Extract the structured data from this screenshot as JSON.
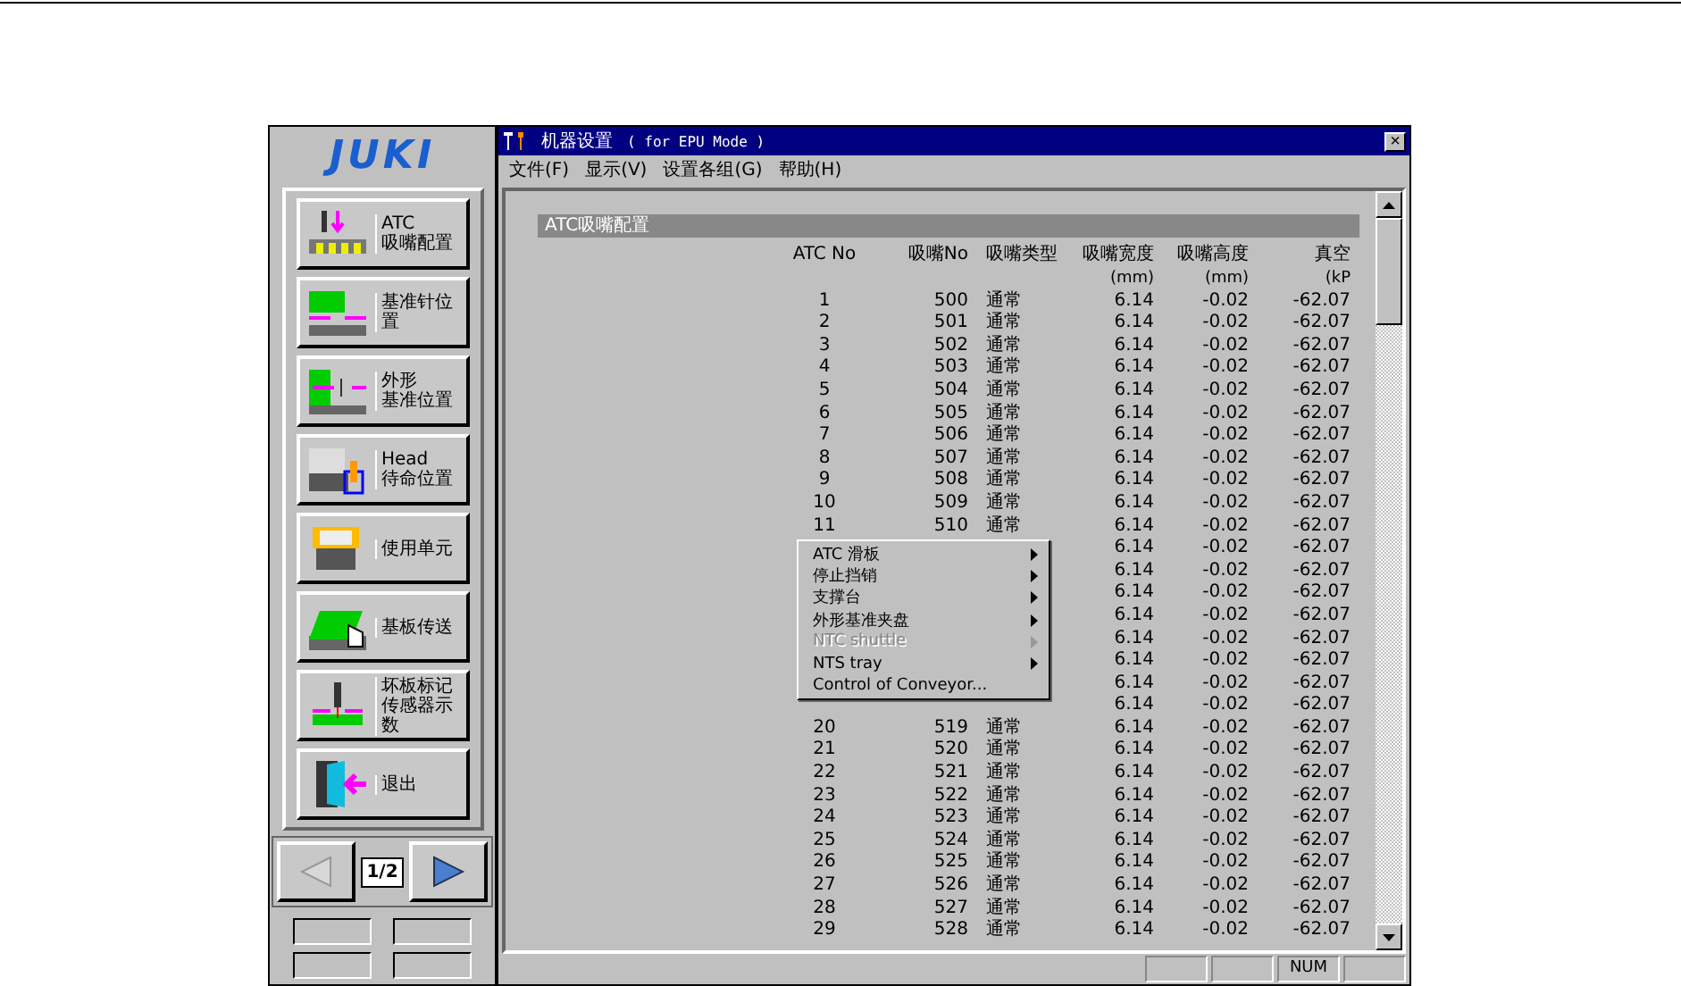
{
  "logo": "JUKI",
  "side_buttons": [
    {
      "lines": [
        "ATC",
        "吸嘴配置"
      ]
    },
    {
      "lines": [
        "基准针位置"
      ]
    },
    {
      "lines": [
        "外形",
        "基准位置"
      ]
    },
    {
      "lines": [
        "Head",
        "待命位置"
      ]
    },
    {
      "lines": [
        "使用单元"
      ]
    },
    {
      "lines": [
        "基板传送"
      ]
    },
    {
      "lines": [
        "坏板标记",
        "传感器示数"
      ]
    },
    {
      "lines": [
        "退出"
      ]
    }
  ],
  "pager": {
    "prev_disabled": true,
    "next_disabled": false,
    "page": "1/2"
  },
  "window": {
    "title": "机器设置",
    "subtitle": "( for EPU Mode )",
    "close": "×"
  },
  "menu_bar": [
    "文件(F)",
    "显示(V)",
    "设置各组(G)",
    "帮助(H)"
  ],
  "section": {
    "title": "ATC吸嘴配置"
  },
  "table": {
    "columns": [
      {
        "label": "ATC No"
      },
      {
        "label": "吸嘴No"
      },
      {
        "label": "吸嘴类型"
      },
      {
        "label": "吸嘴宽度",
        "unit": "(mm)"
      },
      {
        "label": "吸嘴高度",
        "unit": "(mm)"
      },
      {
        "label": "真空",
        "unit": "(kP"
      }
    ],
    "rows": [
      [
        "1",
        "500",
        "通常",
        "6.14",
        "-0.02",
        "-62.07"
      ],
      [
        "2",
        "501",
        "通常",
        "6.14",
        "-0.02",
        "-62.07"
      ],
      [
        "3",
        "502",
        "通常",
        "6.14",
        "-0.02",
        "-62.07"
      ],
      [
        "4",
        "503",
        "通常",
        "6.14",
        "-0.02",
        "-62.07"
      ],
      [
        "5",
        "504",
        "通常",
        "6.14",
        "-0.02",
        "-62.07"
      ],
      [
        "6",
        "505",
        "通常",
        "6.14",
        "-0.02",
        "-62.07"
      ],
      [
        "7",
        "506",
        "通常",
        "6.14",
        "-0.02",
        "-62.07"
      ],
      [
        "8",
        "507",
        "通常",
        "6.14",
        "-0.02",
        "-62.07"
      ],
      [
        "9",
        "508",
        "通常",
        "6.14",
        "-0.02",
        "-62.07"
      ],
      [
        "10",
        "509",
        "通常",
        "6.14",
        "-0.02",
        "-62.07"
      ],
      [
        "11",
        "510",
        "通常",
        "6.14",
        "-0.02",
        "-62.07"
      ],
      [
        "",
        "",
        "",
        "6.14",
        "-0.02",
        "-62.07"
      ],
      [
        "",
        "",
        "",
        "6.14",
        "-0.02",
        "-62.07"
      ],
      [
        "",
        "",
        "",
        "6.14",
        "-0.02",
        "-62.07"
      ],
      [
        "",
        "",
        "",
        "6.14",
        "-0.02",
        "-62.07"
      ],
      [
        "",
        "",
        "",
        "6.14",
        "-0.02",
        "-62.07"
      ],
      [
        "",
        "",
        "",
        "6.14",
        "-0.02",
        "-62.07"
      ],
      [
        "",
        "",
        "",
        "6.14",
        "-0.02",
        "-62.07"
      ],
      [
        "",
        "",
        "",
        "6.14",
        "-0.02",
        "-62.07"
      ],
      [
        "20",
        "519",
        "通常",
        "6.14",
        "-0.02",
        "-62.07"
      ],
      [
        "21",
        "520",
        "通常",
        "6.14",
        "-0.02",
        "-62.07"
      ],
      [
        "22",
        "521",
        "通常",
        "6.14",
        "-0.02",
        "-62.07"
      ],
      [
        "23",
        "522",
        "通常",
        "6.14",
        "-0.02",
        "-62.07"
      ],
      [
        "24",
        "523",
        "通常",
        "6.14",
        "-0.02",
        "-62.07"
      ],
      [
        "25",
        "524",
        "通常",
        "6.14",
        "-0.02",
        "-62.07"
      ],
      [
        "26",
        "525",
        "通常",
        "6.14",
        "-0.02",
        "-62.07"
      ],
      [
        "27",
        "526",
        "通常",
        "6.14",
        "-0.02",
        "-62.07"
      ],
      [
        "28",
        "527",
        "通常",
        "6.14",
        "-0.02",
        "-62.07"
      ],
      [
        "29",
        "528",
        "通常",
        "6.14",
        "-0.02",
        "-62.07"
      ]
    ]
  },
  "context_menu": [
    {
      "label": "ATC 滑板",
      "submenu": true,
      "disabled": false
    },
    {
      "label": "停止挡销",
      "submenu": true,
      "disabled": false
    },
    {
      "label": "支撑台",
      "submenu": true,
      "disabled": false
    },
    {
      "label": "外形基准夹盘",
      "submenu": true,
      "disabled": false
    },
    {
      "label": "NTC shuttle",
      "submenu": true,
      "disabled": true
    },
    {
      "label": "NTS tray",
      "submenu": true,
      "disabled": false
    },
    {
      "label": "Control of Conveyor...",
      "submenu": false,
      "disabled": false
    }
  ],
  "status_bar": {
    "num_indicator": "NUM"
  }
}
